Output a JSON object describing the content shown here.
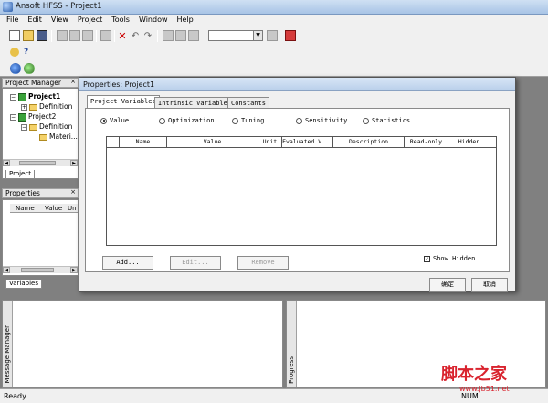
{
  "app": {
    "title": "Ansoft HFSS - Project1"
  },
  "menu": [
    "File",
    "Edit",
    "View",
    "Project",
    "Tools",
    "Window",
    "Help"
  ],
  "project_manager": {
    "title": "Project Manager",
    "tree": [
      {
        "label": "Project1"
      },
      {
        "label": "Definition"
      },
      {
        "label": "Project2"
      },
      {
        "label": "Definition"
      },
      {
        "label": "Materi..."
      }
    ],
    "tab": "Project"
  },
  "properties_panel": {
    "title": "Properties",
    "columns": [
      "Name",
      "Value",
      "Un"
    ],
    "tab": "Variables"
  },
  "bottom": {
    "message_manager": "Message Manager",
    "progress": "Progress"
  },
  "status": {
    "text": "Ready",
    "right": "NUM"
  },
  "dialog": {
    "title": "Properties: Project1",
    "tabs": [
      "Project Variables",
      "Intrinsic Variables",
      "Constants"
    ],
    "radios": [
      {
        "label": "Value",
        "selected": true
      },
      {
        "label": "Optimization",
        "selected": false
      },
      {
        "label": "Tuning",
        "selected": false
      },
      {
        "label": "Sensitivity",
        "selected": false
      },
      {
        "label": "Statistics",
        "selected": false
      }
    ],
    "columns": [
      "Name",
      "Value",
      "Unit",
      "Evaluated V...",
      "Description",
      "Read-only",
      "Hidden"
    ],
    "buttons": {
      "add": "Add...",
      "edit": "Edit...",
      "remove": "Remove",
      "ok": "确定",
      "cancel": "取消"
    },
    "show_hidden": {
      "label": "Show Hidden",
      "checked": true
    }
  },
  "watermark": {
    "main": "脚本之家",
    "url": "www.jb51.net"
  }
}
